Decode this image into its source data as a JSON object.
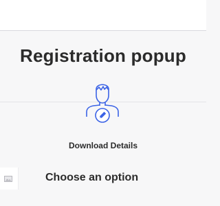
{
  "popup": {
    "title": "Registration popup",
    "action_label": "Download Details",
    "section_heading": "Choose an option"
  },
  "icons": {
    "user_edit": "user-edit-icon",
    "image_placeholder": "image-placeholder-icon"
  },
  "colors": {
    "accent": "#3b63e6",
    "title_text": "#2b2b2b",
    "background": "#f7f7f8"
  }
}
